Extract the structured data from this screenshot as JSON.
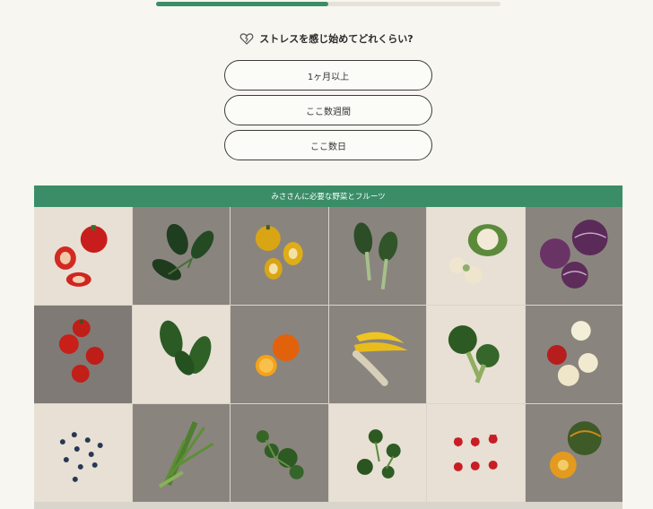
{
  "progress": {
    "fraction": 0.5
  },
  "question": {
    "text": "ストレスを感じ始めてどれくらい?",
    "icon": "broken-heart-icon"
  },
  "options": [
    {
      "label": "1ヶ月以上"
    },
    {
      "label": "ここ数週間"
    },
    {
      "label": "ここ数日"
    }
  ],
  "banner": {
    "text": "みささんに必要な野菜とフルーツ"
  },
  "produce_grid": [
    "red-bell-pepper",
    "kale",
    "yellow-bell-pepper",
    "bok-choy",
    "cauliflower",
    "red-cabbage",
    "tomatoes",
    "spinach",
    "oranges",
    "bananas",
    "broccoli",
    "apples",
    "blueberries",
    "mizuna",
    "parsley",
    "herbs",
    "strawberries",
    "pumpkin"
  ],
  "colors": {
    "accent": "#3a8d67",
    "track": "#e6e2d8",
    "background": "#f7f6f1"
  }
}
